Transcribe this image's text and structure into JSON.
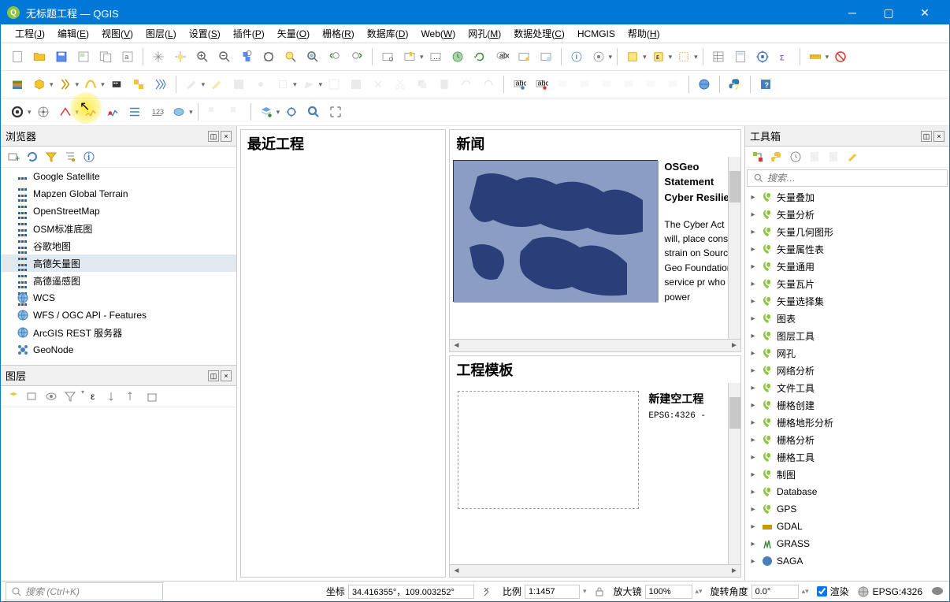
{
  "title": "无标题工程 — QGIS",
  "menus": [
    "工程(J)",
    "编辑(E)",
    "视图(V)",
    "图层(L)",
    "设置(S)",
    "插件(P)",
    "矢量(O)",
    "栅格(R)",
    "数据库(D)",
    "Web(W)",
    "网孔(M)",
    "数据处理(C)",
    "HCMGIS",
    "帮助(H)"
  ],
  "browser": {
    "title": "浏览器",
    "items": [
      {
        "label": "Google Satellite",
        "icon": "grid"
      },
      {
        "label": "Mapzen Global Terrain",
        "icon": "grid"
      },
      {
        "label": "OpenStreetMap",
        "icon": "grid"
      },
      {
        "label": "OSM标准底图",
        "icon": "grid"
      },
      {
        "label": "谷歌地图",
        "icon": "grid"
      },
      {
        "label": "高德矢量图",
        "icon": "grid",
        "sel": true
      },
      {
        "label": "高德遥感图",
        "icon": "grid"
      },
      {
        "label": "WCS",
        "icon": "globe"
      },
      {
        "label": "WFS / OGC API - Features",
        "icon": "globe"
      },
      {
        "label": "ArcGIS REST 服务器",
        "icon": "globe"
      },
      {
        "label": "GeoNode",
        "icon": "flower"
      }
    ]
  },
  "layers": {
    "title": "图层"
  },
  "recent": {
    "title": "最近工程"
  },
  "news": {
    "title": "新闻",
    "headline": "OSGeo Statement Cyber Resilien",
    "body": "The Cyber Act will, place cons strain on Source Geo Foundation service pr who power"
  },
  "templates": {
    "title": "工程模板",
    "new_title": "新建空工程",
    "new_sub": "EPSG:4326 - "
  },
  "toolbox": {
    "title": "工具箱",
    "search_placeholder": "搜索…",
    "items": [
      "矢量叠加",
      "矢量分析",
      "矢量几何图形",
      "矢量属性表",
      "矢量通用",
      "矢量瓦片",
      "矢量选择集",
      "图表",
      "图层工具",
      "网孔",
      "网络分析",
      "文件工具",
      "栅格创建",
      "栅格地形分析",
      "栅格分析",
      "栅格工具",
      "制图",
      "Database",
      "GPS",
      "GDAL",
      "GRASS",
      "SAGA"
    ]
  },
  "status": {
    "search": "搜索 (Ctrl+K)",
    "coord_label": "坐标",
    "coord": "34.416355°，109.003252°",
    "scale_label": "比例",
    "scale": "1:1457",
    "mag_label": "放大镜",
    "mag": "100%",
    "rot_label": "旋转角度",
    "rot": "0.0°",
    "render": "渲染",
    "crs": "EPSG:4326"
  }
}
